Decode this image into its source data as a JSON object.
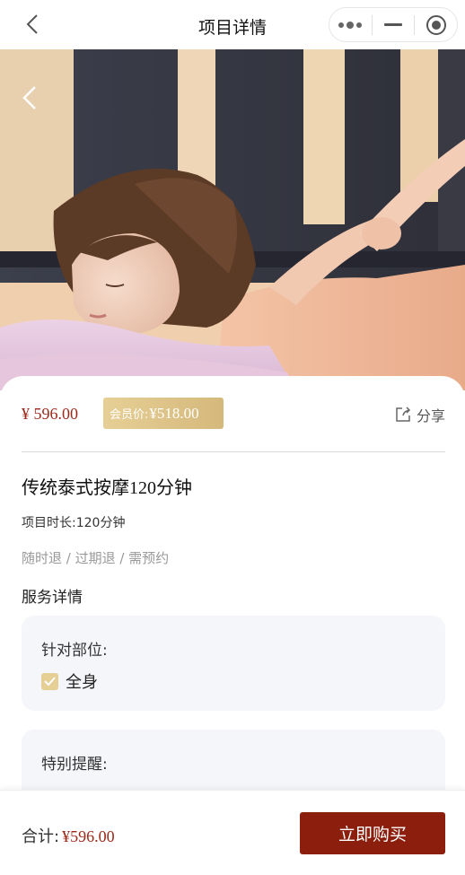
{
  "navbar": {
    "title": "项目详情",
    "back_icon": "chevron-left-icon",
    "menu_icon": "more-dots-icon",
    "minimize_icon": "minus-icon",
    "close_icon": "target-circle-icon"
  },
  "hero": {
    "image_alt": "woman receiving thai massage",
    "back_icon": "chevron-left-icon"
  },
  "product": {
    "price": "¥ 596.00",
    "member_label": "会员价:",
    "member_price": "¥518.00",
    "share_label": "分享",
    "share_icon": "share-icon",
    "title_prefix": "传统泰式按摩",
    "title_number": "120",
    "title_suffix": "分钟",
    "duration": "项目时长:120分钟",
    "tags": "随时退 / 过期退 / 需预约"
  },
  "service": {
    "section_title": "服务详情",
    "target_label": "针对部位:",
    "target_option": "全身",
    "target_checked": true,
    "reminder_label": "特别提醒:"
  },
  "footer": {
    "total_label": "合计:",
    "total_value": "¥596.00",
    "buy_label": "立即购买"
  },
  "colors": {
    "accent": "#8b1e0c",
    "price": "#9b2a1a",
    "gold": "#e6cf95",
    "box_bg": "#f5f6fa"
  }
}
